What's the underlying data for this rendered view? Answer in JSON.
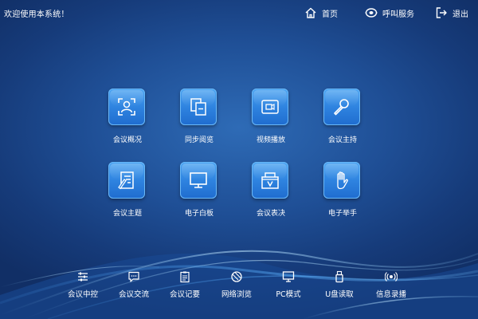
{
  "header": {
    "welcome": "欢迎使用本系统！",
    "nav": [
      {
        "label": "首页",
        "icon": "home-icon"
      },
      {
        "label": "呼叫服务",
        "icon": "call-service-icon"
      },
      {
        "label": "退出",
        "icon": "logout-icon"
      }
    ]
  },
  "main": {
    "tiles": [
      {
        "label": "会议概况",
        "icon": "meeting-overview-icon"
      },
      {
        "label": "同步阅览",
        "icon": "sync-reading-icon"
      },
      {
        "label": "视频播放",
        "icon": "video-play-icon"
      },
      {
        "label": "会议主持",
        "icon": "microphone-icon"
      },
      {
        "label": "会议主题",
        "icon": "meeting-topic-icon"
      },
      {
        "label": "电子白板",
        "icon": "whiteboard-icon"
      },
      {
        "label": "会议表决",
        "icon": "vote-icon"
      },
      {
        "label": "电子举手",
        "icon": "raise-hand-icon"
      }
    ]
  },
  "bottom_bar": {
    "items": [
      {
        "label": "会议中控",
        "icon": "central-control-icon"
      },
      {
        "label": "会议交流",
        "icon": "chat-icon"
      },
      {
        "label": "会议记要",
        "icon": "minutes-icon"
      },
      {
        "label": "网络浏览",
        "icon": "browser-icon"
      },
      {
        "label": "PC模式",
        "icon": "pc-icon"
      },
      {
        "label": "U盘读取",
        "icon": "usb-icon"
      },
      {
        "label": "信息录播",
        "icon": "broadcast-icon"
      }
    ]
  },
  "colors": {
    "background": "#1f4f96",
    "tile": "#2f84e0",
    "text": "#ffffff"
  }
}
